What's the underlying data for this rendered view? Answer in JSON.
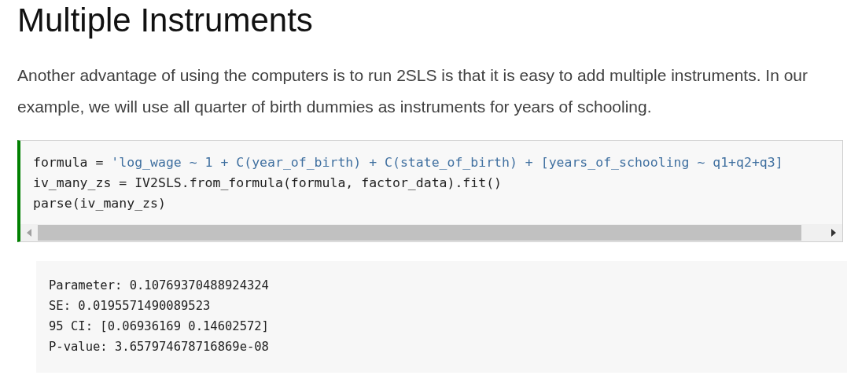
{
  "heading": "Multiple Instruments",
  "paragraph": "Another advantage of using the computers is to run 2SLS is that it is easy to add multiple instruments. In our example, we will use all quarter of birth dummies as instruments for years of schooling.",
  "code_cell": {
    "lines": [
      [
        {
          "kind": "plain",
          "text": "formula = "
        },
        {
          "kind": "string",
          "text": "'log_wage ~ 1 + C(year_of_birth) + C(state_of_birth) + [years_of_schooling ~ q1+q2+q3]"
        }
      ],
      [
        {
          "kind": "plain",
          "text": "iv_many_zs = IV2SLS.from_formula(formula, factor_data).fit()"
        }
      ],
      [
        {
          "kind": "plain",
          "text": "parse(iv_many_zs)"
        }
      ]
    ]
  },
  "output": {
    "lines": [
      "Parameter: 0.10769370488924324",
      "SE: 0.0195571490089523",
      "95 CI: [0.06936169 0.14602572]",
      "P-value: 3.657974678716869e-08"
    ]
  }
}
